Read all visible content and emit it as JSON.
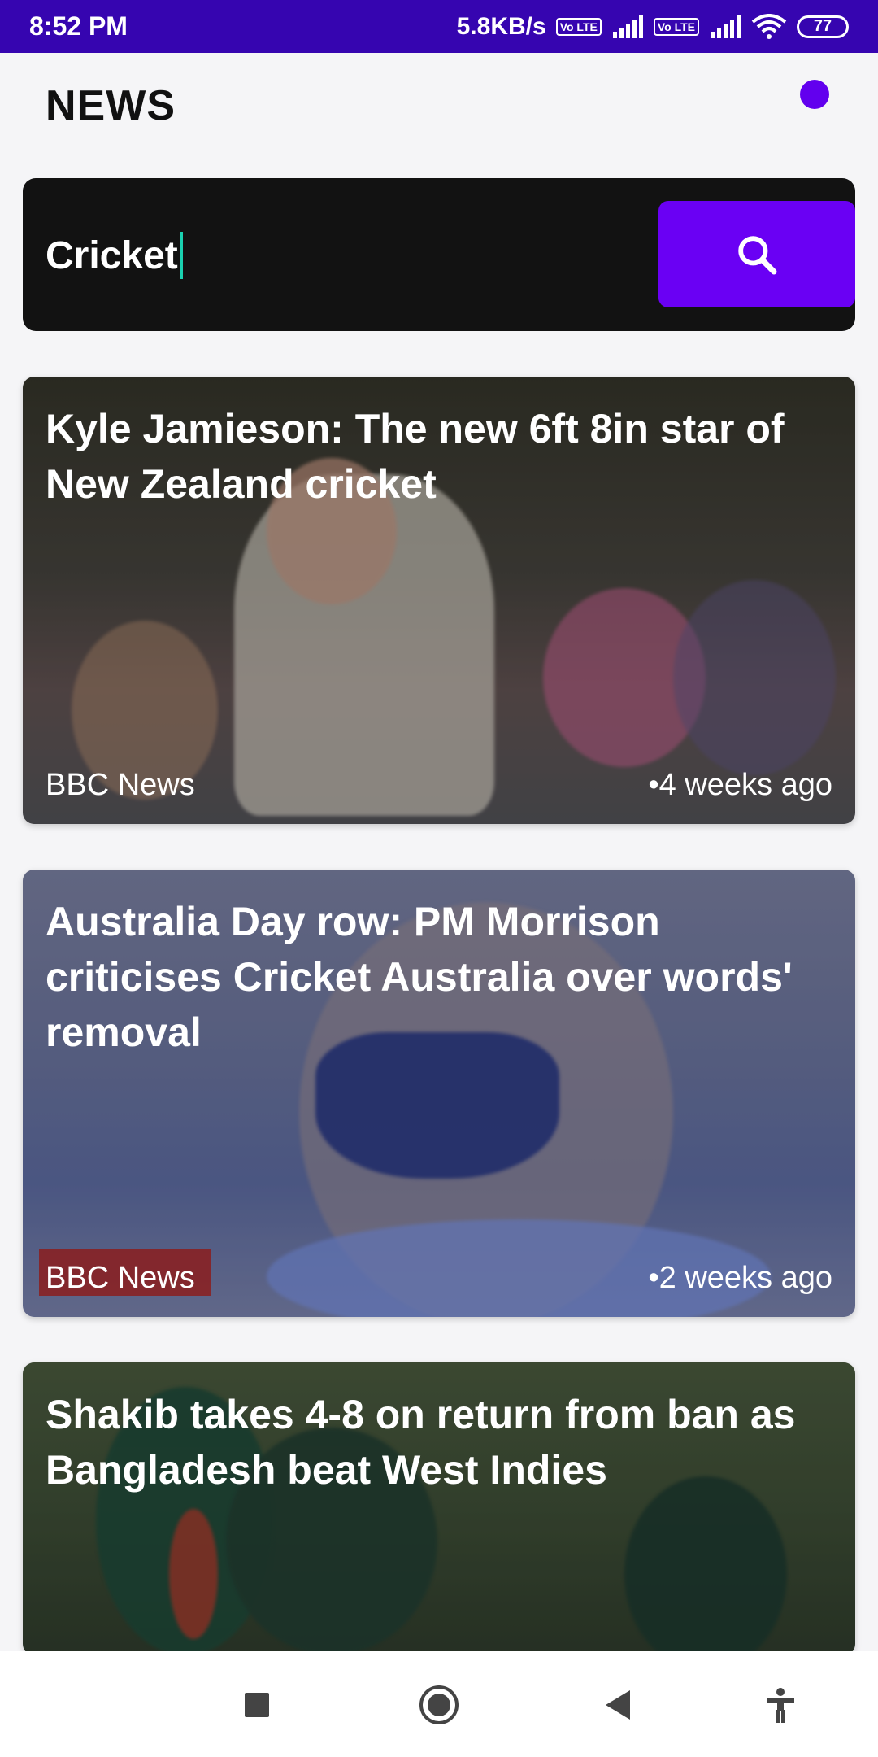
{
  "status_bar": {
    "time": "8:52 PM",
    "network_speed": "5.8KB/s",
    "lte_badge_1": "Vo LTE",
    "lte_badge_2": "Vo LTE",
    "battery": "77",
    "icons": [
      "signal-icon",
      "wifi-icon",
      "battery-icon"
    ]
  },
  "header": {
    "title": "NEWS"
  },
  "search": {
    "value": "Cricket",
    "button_icon": "search-icon"
  },
  "articles": [
    {
      "headline": "Kyle Jamieson: The new 6ft 8in star of New Zealand cricket",
      "source": "BBC News",
      "time": "•4 weeks ago"
    },
    {
      "headline": "Australia Day row: PM Morrison criticises Cricket Australia over words' removal",
      "source": "BBC News",
      "time": "•2 weeks ago"
    },
    {
      "headline": "Shakib takes 4-8 on return from ban as Bangladesh beat West Indies",
      "source": "",
      "time": ""
    }
  ],
  "nav_bar": {
    "icons": [
      "recents-square-icon",
      "home-circle-icon",
      "back-triangle-icon",
      "accessibility-icon"
    ]
  },
  "colors": {
    "status_bar": "#3605b0",
    "accent": "#6200ee",
    "search_button": "#6a00f4",
    "search_bg": "#121212"
  }
}
